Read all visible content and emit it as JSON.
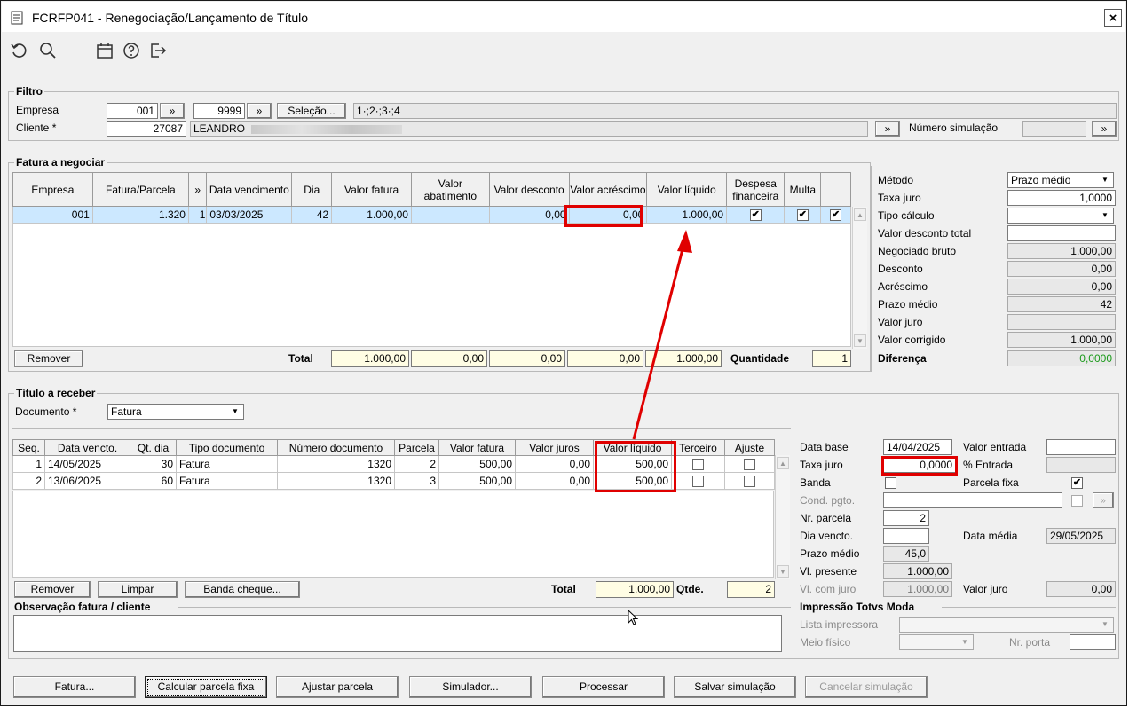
{
  "window": {
    "title": "FCRFP041 - Renegociação/Lançamento de Título",
    "close_label": "×"
  },
  "filtro": {
    "title": "Filtro",
    "empresa_label": "Empresa",
    "empresa_value": "001",
    "empresa2_value": "9999",
    "selecao_label": "Seleção...",
    "selecao_value": "1·;2·;3·;4",
    "cliente_label": "Cliente *",
    "cliente_value": "27087",
    "cliente_nome": "LEANDRO",
    "numero_simulacao_label": "Número simulação",
    "more_label": "»"
  },
  "fatura": {
    "title": "Fatura a negociar",
    "columns": [
      "Empresa",
      "Fatura/Parcela",
      "»",
      "Data vencimento",
      "Dia",
      "Valor fatura",
      "Valor abatimento",
      "Valor desconto",
      "Valor acréscimo",
      "Valor líquido",
      "Despesa financeira",
      "Multa",
      ""
    ],
    "rows": [
      {
        "empresa": "001",
        "fatura": "1.320",
        "parcela": "1",
        "data": "03/03/2025",
        "dia": "42",
        "valor_fatura": "1.000,00",
        "abatimento": "",
        "desconto": "0,00",
        "acrescimo": "0,00",
        "liquido": "1.000,00",
        "despesa": "✔",
        "multa": "✔",
        "extra": "✔"
      }
    ],
    "remover_label": "Remover",
    "total_label": "Total",
    "totals": {
      "fatura": "1.000,00",
      "abatimento": "0,00",
      "desconto": "0,00",
      "acrescimo": "0,00",
      "liquido": "1.000,00"
    },
    "quantidade_label": "Quantidade",
    "quantidade_value": "1"
  },
  "metodo": {
    "metodo_label": "Método",
    "metodo_value": "Prazo médio",
    "taxa_label": "Taxa juro",
    "taxa_value": "1,0000",
    "tipo_label": "Tipo cálculo",
    "tipo_value": "",
    "desc_total_label": "Valor desconto total",
    "desc_total_value": "",
    "negociado_label": "Negociado bruto",
    "negociado_value": "1.000,00",
    "desconto_label": "Desconto",
    "desconto_value": "0,00",
    "acrescimo_label": "Acréscimo",
    "acrescimo_value": "0,00",
    "prazo_label": "Prazo médio",
    "prazo_value": "42",
    "juro_label": "Valor juro",
    "juro_value": "",
    "corrigido_label": "Valor corrigido",
    "corrigido_value": "1.000,00",
    "diferenca_label": "Diferença",
    "diferenca_value": "0,0000"
  },
  "titulo": {
    "title": "Título a receber",
    "documento_label": "Documento *",
    "documento_value": "Fatura",
    "columns": [
      "Seq.",
      "Data vencto.",
      "Qt. dia",
      "Tipo documento",
      "Número documento",
      "Parcela",
      "Valor fatura",
      "Valor juros",
      "Valor líquido",
      "Terceiro",
      "Ajuste"
    ],
    "rows": [
      {
        "seq": "1",
        "data": "14/05/2025",
        "qt": "30",
        "tipo": "Fatura",
        "numero": "1320",
        "parcela": "2",
        "valor": "500,00",
        "juros": "0,00",
        "liquido": "500,00"
      },
      {
        "seq": "2",
        "data": "13/06/2025",
        "qt": "60",
        "tipo": "Fatura",
        "numero": "1320",
        "parcela": "3",
        "valor": "500,00",
        "juros": "0,00",
        "liquido": "500,00"
      }
    ],
    "remover_label": "Remover",
    "limpar_label": "Limpar",
    "banda_label": "Banda cheque...",
    "total_label": "Total",
    "total_value": "1.000,00",
    "qtde_label": "Qtde.",
    "qtde_value": "2"
  },
  "simulacao": {
    "data_base_label": "Data base",
    "data_base_value": "14/04/2025",
    "valor_entrada_label": "Valor entrada",
    "valor_entrada_value": "",
    "taxa_label": "Taxa juro",
    "taxa_value": "0,0000",
    "entrada_pct_label": "% Entrada",
    "entrada_pct_value": "",
    "banda_label": "Banda",
    "parcela_fixa_label": "Parcela fixa",
    "cond_label": "Cond. pgto.",
    "cond_value": "",
    "nr_parcela_label": "Nr. parcela",
    "nr_parcela_value": "2",
    "dia_vencto_label": "Dia vencto.",
    "dia_vencto_value": "",
    "data_media_label": "Data média",
    "data_media_value": "29/05/2025",
    "prazo_label": "Prazo médio",
    "prazo_value": "45,0",
    "vl_presente_label": "Vl. presente",
    "vl_presente_value": "1.000,00",
    "vl_juro_label": "Vl. com juro",
    "vl_juro_value": "1.000,00",
    "valor_juro_label": "Valor juro",
    "valor_juro_value": "0,00"
  },
  "obs": {
    "title": "Observação fatura / cliente",
    "value": ""
  },
  "impressao": {
    "title": "Impressão Totvs Moda",
    "lista_label": "Lista impressora",
    "meio_label": "Meio físico",
    "porta_label": "Nr. porta"
  },
  "buttons": {
    "fatura": "Fatura...",
    "calcular": "Calcular parcela fixa",
    "ajustar": "Ajustar parcela",
    "simulador": "Simulador...",
    "processar": "Processar",
    "salvar": "Salvar simulação",
    "cancelar": "Cancelar simulação"
  },
  "colors": {
    "accent_red": "#e00000",
    "selected_row": "#cce8ff",
    "total_field": "#fffde4",
    "diferenca_green": "#1a9a1a"
  }
}
